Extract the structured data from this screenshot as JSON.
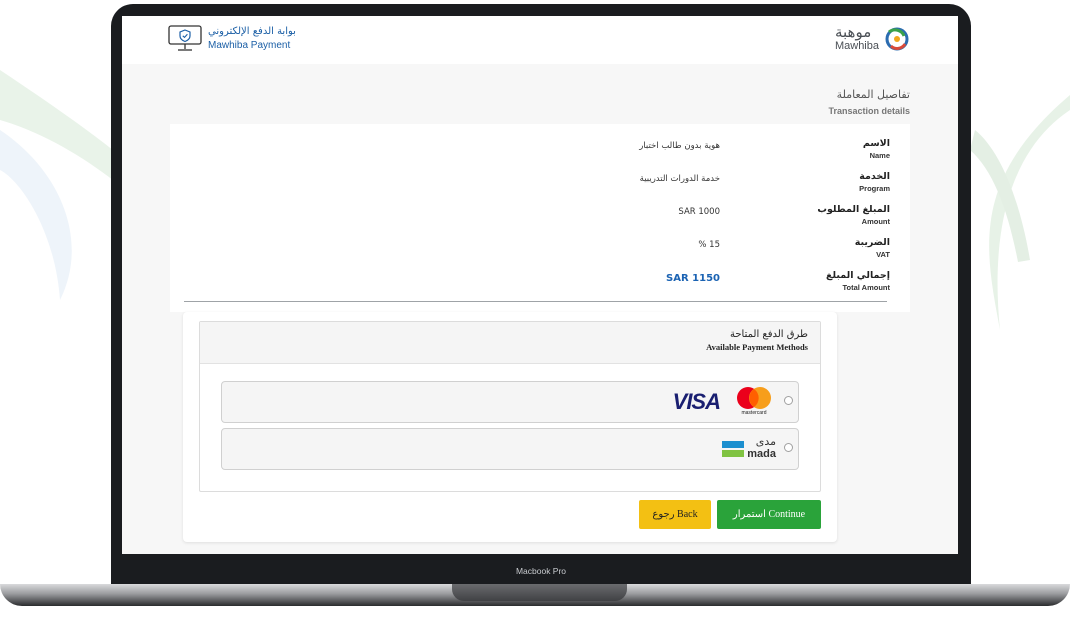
{
  "device": {
    "label": "Macbook Pro"
  },
  "header": {
    "gateway_ar": "بوابة الدفع الإلكتروني",
    "gateway_en": "Mawhiba Payment",
    "logo_ar": "موهبة",
    "logo_en": "Mawhiba"
  },
  "section": {
    "title_ar": "تفاصيل المعاملة",
    "title_en": "Transaction details"
  },
  "details": [
    {
      "label_ar": "الاسم",
      "label_en": "Name",
      "value": "هوية بدون طالب اختبار"
    },
    {
      "label_ar": "الخدمة",
      "label_en": "Program",
      "value": "خدمة الدورات التدريبية"
    },
    {
      "label_ar": "المبلغ المطلوب",
      "label_en": "Amount",
      "value": "SAR 1000"
    },
    {
      "label_ar": "الضريبة",
      "label_en": "VAT",
      "value": "15 %"
    },
    {
      "label_ar": "إجمالي المبلغ",
      "label_en": "Total Amount",
      "value": "SAR 1150"
    }
  ],
  "payment": {
    "title_ar": "طرق الدفع المتاحة",
    "title_en": "Available Payment Methods",
    "options": [
      {
        "brand_text": "VISA",
        "brand2_text": "mastercard",
        "selected": false
      },
      {
        "brand_text": "مدى",
        "brand2_text": "mada",
        "selected": false
      }
    ]
  },
  "buttons": {
    "continue": "استمرار Continue",
    "back": "رجوع Back"
  },
  "colors": {
    "green": "#2aa33a",
    "yellow": "#f3c013",
    "blue": "#1b63b3",
    "visa_blue": "#1a1f71"
  }
}
